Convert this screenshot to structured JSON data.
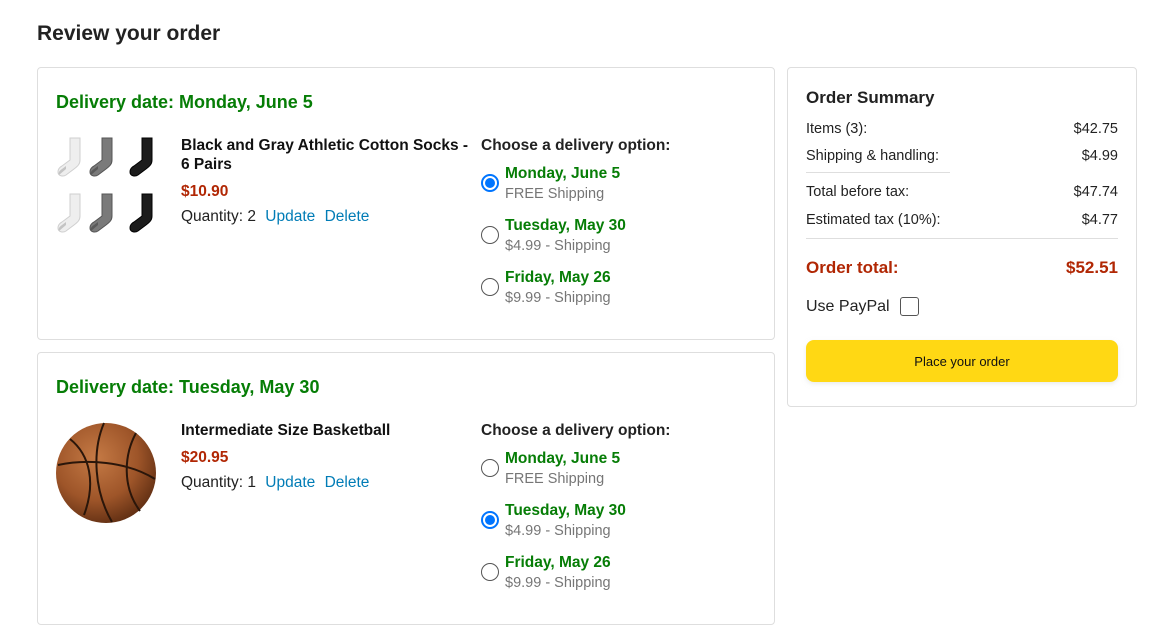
{
  "page": {
    "title": "Review your order"
  },
  "items": [
    {
      "delivery_date": "Delivery date: Monday, June 5",
      "name": "Black and Gray Athletic Cotton Socks - 6 Pairs",
      "price": "$10.90",
      "quantity_label": "Quantity: 2",
      "update_label": "Update",
      "delete_label": "Delete",
      "image_icon": "socks-image",
      "delivery_title": "Choose a delivery option:",
      "options": [
        {
          "date": "Monday, June 5",
          "price": "FREE Shipping",
          "selected": true
        },
        {
          "date": "Tuesday, May 30",
          "price": "$4.99 - Shipping",
          "selected": false
        },
        {
          "date": "Friday, May 26",
          "price": "$9.99 - Shipping",
          "selected": false
        }
      ]
    },
    {
      "delivery_date": "Delivery date: Tuesday, May 30",
      "name": "Intermediate Size Basketball",
      "price": "$20.95",
      "quantity_label": "Quantity: 1",
      "update_label": "Update",
      "delete_label": "Delete",
      "image_icon": "basketball-image",
      "delivery_title": "Choose a delivery option:",
      "options": [
        {
          "date": "Monday, June 5",
          "price": "FREE Shipping",
          "selected": false
        },
        {
          "date": "Tuesday, May 30",
          "price": "$4.99 - Shipping",
          "selected": true
        },
        {
          "date": "Friday, May 26",
          "price": "$9.99 - Shipping",
          "selected": false
        }
      ]
    }
  ],
  "summary": {
    "title": "Order Summary",
    "items_label": "Items (3):",
    "items_value": "$42.75",
    "shipping_label": "Shipping & handling:",
    "shipping_value": "$4.99",
    "before_tax_label": "Total before tax:",
    "before_tax_value": "$47.74",
    "tax_label": "Estimated tax (10%):",
    "tax_value": "$4.77",
    "total_label": "Order total:",
    "total_value": "$52.51",
    "paypal_label": "Use PayPal",
    "place_order_label": "Place your order"
  },
  "colors": {
    "delivery_green": "#067d06",
    "price_red": "#b12704",
    "link_blue": "#017cb6",
    "button_yellow": "#ffd814",
    "radio_blue": "#0075ff"
  }
}
